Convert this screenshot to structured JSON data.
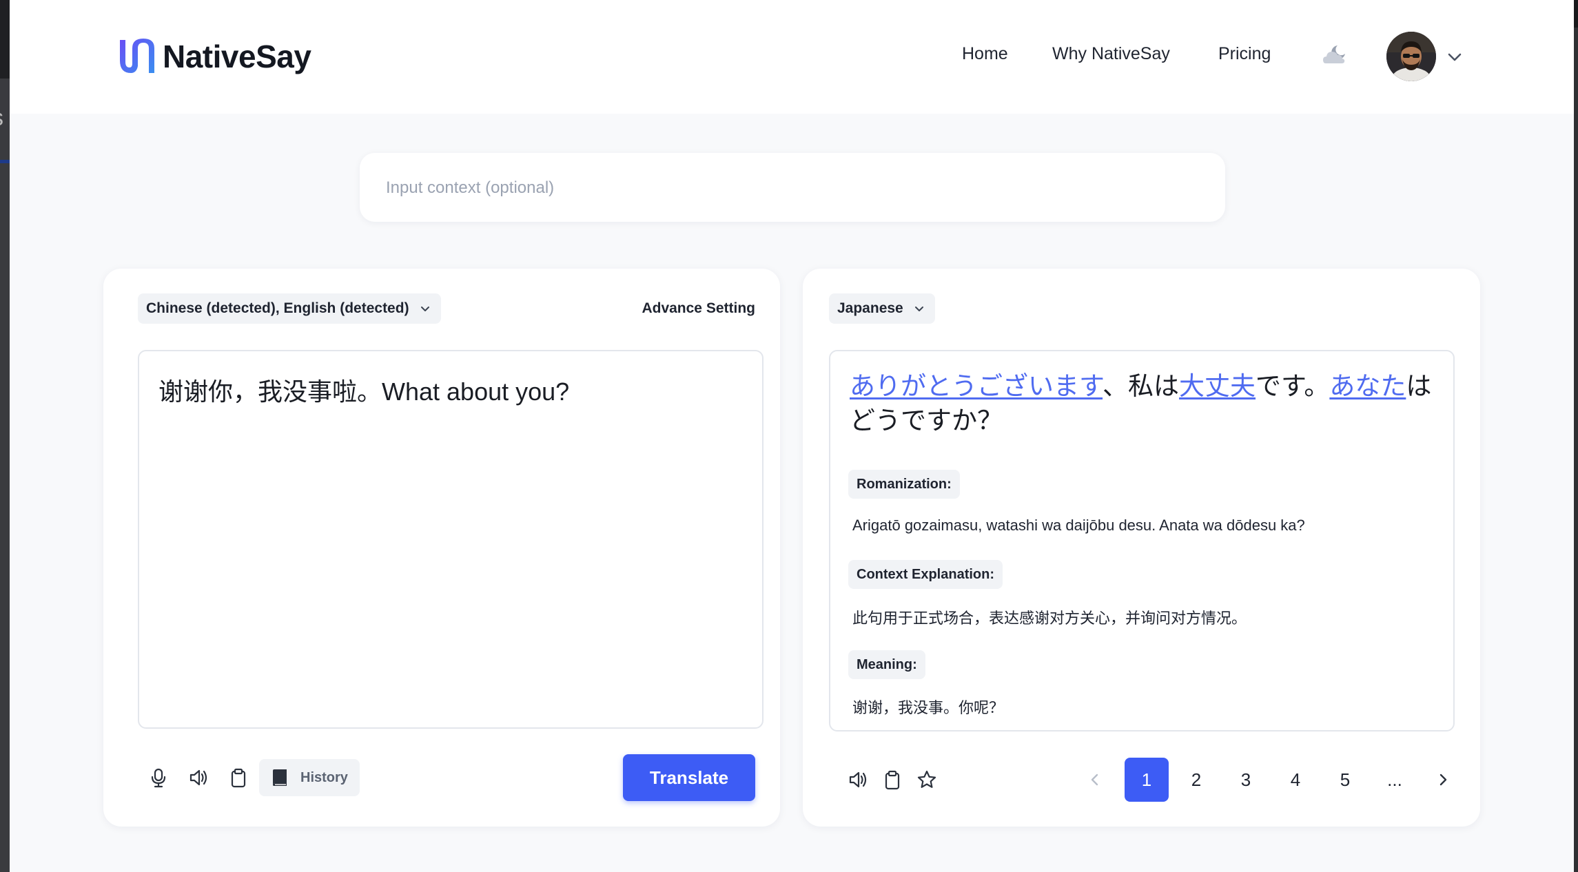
{
  "brand": {
    "name": "NativeSay"
  },
  "nav": {
    "home": "Home",
    "why": "Why NativeSay",
    "pricing": "Pricing"
  },
  "context_input": {
    "placeholder": "Input context (optional)",
    "value": ""
  },
  "source": {
    "language": "Chinese (detected), English (detected)",
    "advance_setting": "Advance Setting",
    "text": "谢谢你，我没事啦。What about you?",
    "history_label": "History",
    "translate_label": "Translate"
  },
  "target": {
    "language": "Japanese",
    "translation_parts": {
      "p1": "ありがとうございます",
      "p2": "、私は",
      "p3": "大丈夫",
      "p4": "です。",
      "p5": "あなた",
      "p6": "はどうですか？"
    },
    "romanization_label": "Romanization:",
    "romanization": "Arigatō gozaimasu, watashi wa daijōbu desu. Anata wa dōdesu ka?",
    "context_label": "Context Explanation:",
    "context": "此句用于正式场合，表达感谢对方关心，并询问对方情况。",
    "meaning_label": "Meaning:",
    "meaning": "谢谢，我没事。你呢？"
  },
  "pagination": {
    "pages": [
      "1",
      "2",
      "3",
      "4",
      "5",
      "..."
    ],
    "current": "1"
  },
  "colors": {
    "accent": "#3d5cf5",
    "link": "#4f6bf0"
  },
  "icons": [
    "mic-icon",
    "speaker-icon",
    "clipboard-icon",
    "book-icon",
    "star-icon",
    "moon-cloud-icon",
    "chevron-down-icon",
    "chevron-left-icon",
    "chevron-right-icon"
  ]
}
